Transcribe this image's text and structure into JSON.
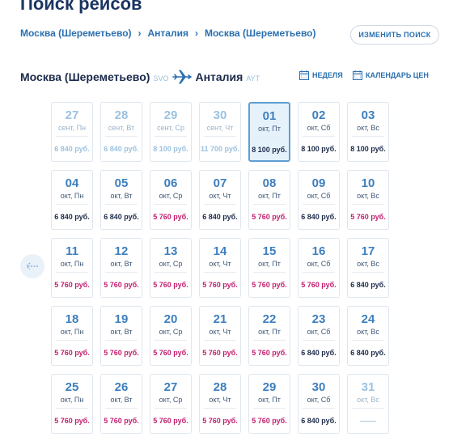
{
  "header": {
    "title": "Поиск рейсов"
  },
  "breadcrumb": [
    "Москва (Шереметьево)",
    "Анталия",
    "Москва (Шереметьево)"
  ],
  "breadcrumb_sep": "›",
  "change_button": "ИЗМЕНИТЬ ПОИСК",
  "route": {
    "from": "Москва (Шереметьево)",
    "from_code": "SVO",
    "to": "Анталия",
    "to_code": "AYT"
  },
  "view_links": {
    "week": "НЕДЕЛЯ",
    "calendar": "КАЛЕНДАРЬ ЦЕН"
  },
  "calendar": [
    [
      {
        "day": "27",
        "wd": "сент, Пн",
        "price": "6 840 руб.",
        "state": "muted"
      },
      {
        "day": "28",
        "wd": "сент, Вт",
        "price": "6 840 руб.",
        "state": "muted"
      },
      {
        "day": "29",
        "wd": "сент, Ср",
        "price": "8 100 руб.",
        "state": "muted"
      },
      {
        "day": "30",
        "wd": "сент, Чт",
        "price": "11 700 руб.",
        "state": "muted"
      },
      {
        "day": "01",
        "wd": "окт, Пт",
        "price": "8 100 руб.",
        "state": "selected"
      },
      {
        "day": "02",
        "wd": "окт, Сб",
        "price": "8 100 руб.",
        "state": "normal"
      },
      {
        "day": "03",
        "wd": "окт, Вс",
        "price": "8 100 руб.",
        "state": "normal"
      }
    ],
    [
      {
        "day": "04",
        "wd": "окт, Пн",
        "price": "6 840 руб.",
        "state": "normal"
      },
      {
        "day": "05",
        "wd": "окт, Вт",
        "price": "6 840 руб.",
        "state": "normal"
      },
      {
        "day": "06",
        "wd": "окт, Ср",
        "price": "5 760 руб.",
        "state": "cheap"
      },
      {
        "day": "07",
        "wd": "окт, Чт",
        "price": "6 840 руб.",
        "state": "normal"
      },
      {
        "day": "08",
        "wd": "окт, Пт",
        "price": "5 760 руб.",
        "state": "cheap"
      },
      {
        "day": "09",
        "wd": "окт, Сб",
        "price": "6 840 руб.",
        "state": "normal"
      },
      {
        "day": "10",
        "wd": "окт, Вс",
        "price": "5 760 руб.",
        "state": "cheap"
      }
    ],
    [
      {
        "day": "11",
        "wd": "окт, Пн",
        "price": "5 760 руб.",
        "state": "cheap"
      },
      {
        "day": "12",
        "wd": "окт, Вт",
        "price": "5 760 руб.",
        "state": "cheap"
      },
      {
        "day": "13",
        "wd": "окт, Ср",
        "price": "5 760 руб.",
        "state": "cheap"
      },
      {
        "day": "14",
        "wd": "окт, Чт",
        "price": "5 760 руб.",
        "state": "cheap"
      },
      {
        "day": "15",
        "wd": "окт, Пт",
        "price": "5 760 руб.",
        "state": "cheap"
      },
      {
        "day": "16",
        "wd": "окт, Сб",
        "price": "5 760 руб.",
        "state": "cheap"
      },
      {
        "day": "17",
        "wd": "окт, Вс",
        "price": "6 840 руб.",
        "state": "normal"
      }
    ],
    [
      {
        "day": "18",
        "wd": "окт, Пн",
        "price": "5 760 руб.",
        "state": "cheap"
      },
      {
        "day": "19",
        "wd": "окт, Вт",
        "price": "5 760 руб.",
        "state": "cheap"
      },
      {
        "day": "20",
        "wd": "окт, Ср",
        "price": "5 760 руб.",
        "state": "cheap"
      },
      {
        "day": "21",
        "wd": "окт, Чт",
        "price": "5 760 руб.",
        "state": "cheap"
      },
      {
        "day": "22",
        "wd": "окт, Пт",
        "price": "5 760 руб.",
        "state": "cheap"
      },
      {
        "day": "23",
        "wd": "окт, Сб",
        "price": "6 840 руб.",
        "state": "normal"
      },
      {
        "day": "24",
        "wd": "окт, Вс",
        "price": "6 840 руб.",
        "state": "normal"
      }
    ],
    [
      {
        "day": "25",
        "wd": "окт, Пн",
        "price": "5 760 руб.",
        "state": "cheap"
      },
      {
        "day": "26",
        "wd": "окт, Вт",
        "price": "5 760 руб.",
        "state": "cheap"
      },
      {
        "day": "27",
        "wd": "окт, Ср",
        "price": "5 760 руб.",
        "state": "cheap"
      },
      {
        "day": "28",
        "wd": "окт, Чт",
        "price": "5 760 руб.",
        "state": "cheap"
      },
      {
        "day": "29",
        "wd": "окт, Пт",
        "price": "5 760 руб.",
        "state": "cheap"
      },
      {
        "day": "30",
        "wd": "окт, Сб",
        "price": "6 840 руб.",
        "state": "normal"
      },
      {
        "day": "31",
        "wd": "окт, Вс",
        "price": "",
        "state": "empty"
      }
    ]
  ]
}
